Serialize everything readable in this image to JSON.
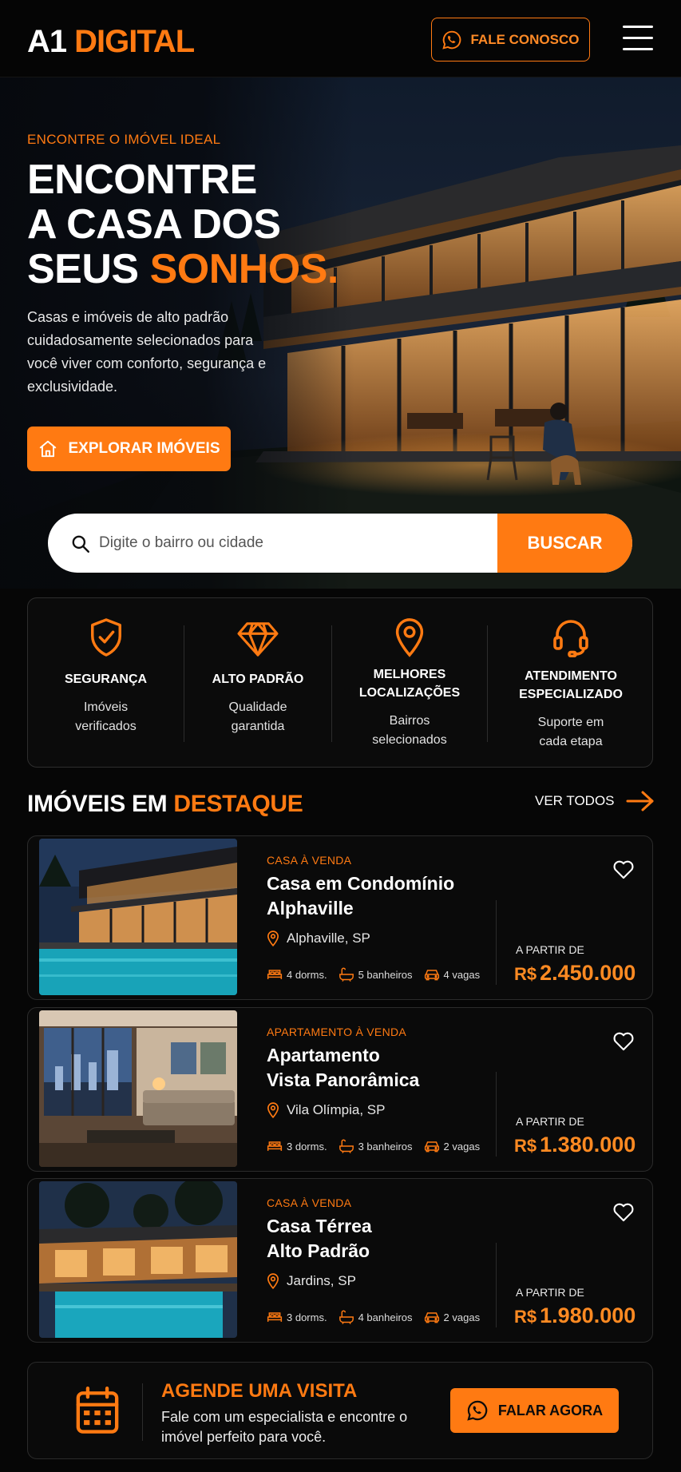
{
  "brand": {
    "logo_a": "A1",
    "logo_b": "DIGITAL",
    "accent": "#ff7a12"
  },
  "header": {
    "contact_label": "FALE CONOSCO",
    "contact_icon": "whatsapp-icon",
    "menu_icon": "hamburger-menu-icon"
  },
  "hero": {
    "eyebrow": "ENCONTRE O IMÓVEL IDEAL",
    "title_line1": "ENCONTRE",
    "title_line2": "A CASA DOS",
    "title_line3_a": "SEUS",
    "title_line3_b": "SONHOS.",
    "subtitle": "Casas e imóveis de alto padrão cuidadosamente selecionados para você viver com conforto, segurança e exclusividade.",
    "cta_label": "EXPLORAR IMÓVEIS"
  },
  "search": {
    "placeholder": "Digite o bairro ou cidade",
    "button_label": "BUSCAR"
  },
  "features": [
    {
      "title": "SEGURANÇA",
      "desc1": "Imóveis",
      "desc2": "verificados",
      "icon": "shield-check-icon"
    },
    {
      "title": "ALTO PADRÃO",
      "desc1": "Qualidade",
      "desc2": "garantida",
      "icon": "diamond-icon"
    },
    {
      "title1": "MELHORES",
      "title2": "LOCALIZAÇÕES",
      "desc1": "Bairros",
      "desc2": "selecionados",
      "icon": "location-pin-icon"
    },
    {
      "title1": "ATENDIMENTO",
      "title2": "ESPECIALIZADO",
      "desc1": "Suporte em",
      "desc2": "cada etapa",
      "icon": "headset-icon"
    }
  ],
  "featured": {
    "title_a": "IMÓVEIS EM",
    "title_b": "DESTAQUE",
    "see_all": "VER TODOS"
  },
  "properties": [
    {
      "type": "CASA À VENDA",
      "title1": "Casa em Condomínio",
      "title2": "Alphaville",
      "location": "Alphaville, SP",
      "beds": "4 dorms.",
      "baths": "5 banheiros",
      "parking": "4 vagas",
      "from": "A PARTIR DE",
      "currency": "R$",
      "price": "2.450.000"
    },
    {
      "type": "APARTAMENTO À VENDA",
      "title1": "Apartamento",
      "title2": "Vista Panorâmica",
      "location": "Vila Olímpia, SP",
      "beds": "3 dorms.",
      "baths": "3 banheiros",
      "parking": "2 vagas",
      "from": "A PARTIR DE",
      "currency": "R$",
      "price": "1.380.000"
    },
    {
      "type": "CASA À VENDA",
      "title1": "Casa Térrea",
      "title2": "Alto Padrão",
      "location": "Jardins, SP",
      "beds": "3 dorms.",
      "baths": "4 banheiros",
      "parking": "2 vagas",
      "from": "A PARTIR DE",
      "currency": "R$",
      "price": "1.980.000"
    }
  ],
  "cta": {
    "title": "AGENDE UMA VISITA",
    "subtitle": "Fale com um especialista e encontre o imóvel perfeito para você.",
    "button_label": "FALAR AGORA",
    "icon": "calendar-icon"
  }
}
